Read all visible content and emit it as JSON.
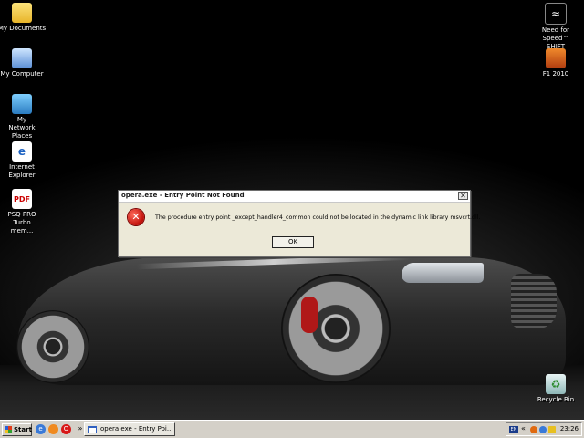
{
  "desktop": {
    "icons_left": [
      {
        "label": "My Documents",
        "icon": "folder-documents-icon"
      },
      {
        "label": "My Computer",
        "icon": "computer-icon"
      },
      {
        "label": "My Network Places",
        "icon": "network-icon"
      },
      {
        "label": "Internet Explorer",
        "icon": "internet-explorer-icon"
      },
      {
        "label": "PSQ PRO Turbo mem...",
        "icon": "pdf-file-icon"
      }
    ],
    "icons_right": [
      {
        "label": "Need for Speed™ SHIFT",
        "icon": "need-for-speed-icon"
      },
      {
        "label": "F1 2010",
        "icon": "f1-game-icon"
      },
      {
        "label": "Recycle Bin",
        "icon": "recycle-bin-icon"
      }
    ]
  },
  "dialog": {
    "title": "opera.exe - Entry Point Not Found",
    "close_glyph": "✕",
    "error_glyph": "✕",
    "message": "The procedure entry point _except_handler4_common could not be located in the dynamic link library msvcrt.dll.",
    "ok_label": "OK"
  },
  "taskbar": {
    "start_label": "Start",
    "quick_launch": [
      {
        "name": "internet-explorer",
        "glyph": "e"
      },
      {
        "name": "firefox",
        "glyph": ""
      },
      {
        "name": "opera",
        "glyph": "O"
      }
    ],
    "overflow_glyph": "»",
    "task_label": "opera.exe - Entry Poi...",
    "tray": {
      "lang": "EN",
      "chevron": "«",
      "clock": "23:26"
    }
  },
  "colors": {
    "dialog_bg": "#ece9d8",
    "error_red": "#c0100a",
    "taskbar_bg": "#d4d0c8"
  }
}
